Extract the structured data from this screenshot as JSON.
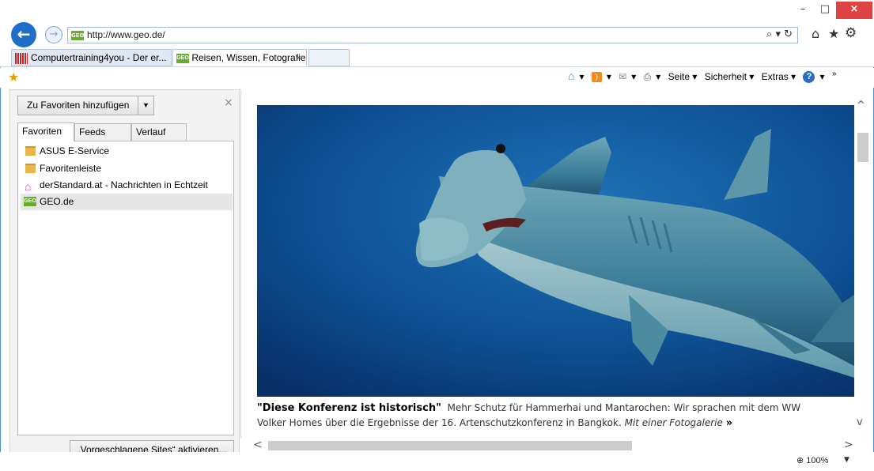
{
  "window": {
    "minimize": "–",
    "maximize": "□",
    "close": "×"
  },
  "nav": {
    "url": "http://www.geo.de/",
    "favicon_text": "GEO",
    "addr_tools": "⌕ ▾ ↻"
  },
  "tabs": [
    {
      "label": "Computertraining4you - Der er...",
      "active": false
    },
    {
      "label": "Reisen, Wissen, Fotografie: ...",
      "active": true,
      "close": "×"
    }
  ],
  "commandbar": {
    "items": [
      "Seite ▾",
      "Sicherheit ▾",
      "Extras ▾"
    ],
    "more": "»"
  },
  "favorites_panel": {
    "add_button": "Zu Favoriten hinzufügen",
    "close": "×",
    "tabs": [
      "Favoriten",
      "Feeds",
      "Verlauf"
    ],
    "items": [
      {
        "label": "ASUS E-Service",
        "icon": "folder-icon"
      },
      {
        "label": "Favoritenleiste",
        "icon": "folder-icon"
      },
      {
        "label": "derStandard.at - Nachrichten in Echtzeit",
        "icon": "house-icon"
      },
      {
        "label": "GEO.de",
        "icon": "geo-favicon",
        "selected": true
      }
    ],
    "suggest_button": "„Vorgeschlagene Sites“ aktivieren..."
  },
  "content": {
    "headline": "\"Diese Konferenz ist historisch\"",
    "teaser_line1": "Mehr Schutz für Hammerhai und Mantarochen: Wir sprachen mit dem WW",
    "teaser_line2": "Volker Homes über die Ergebnisse der 16. Artenschutzkonferenz in Bangkok.",
    "gallery_link": "Mit einer Fotogalerie",
    "gallery_arrow": "»"
  },
  "status": {
    "zoom": "100%"
  },
  "colors": {
    "accent": "#1e6fc9",
    "close_red": "#e04343",
    "geo_green": "#6aab2f",
    "ocean": "#0e4e8c"
  }
}
